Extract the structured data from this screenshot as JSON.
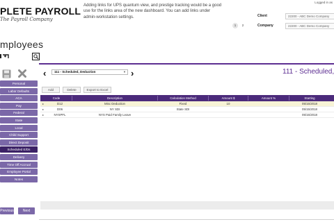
{
  "header": {
    "logo_title": "PLETE PAYROLL",
    "logo_signature": "The Payroll Company",
    "notice": "Adding links for UPS quantum view, and prestige tracking would be a good use for the links area of the new dashboard. You can add links under admin-workstation settings.",
    "logged_in": "Logged in as",
    "client_label": "Client",
    "client_value": "22200 - ABC Demo Company",
    "company_label": "Company",
    "company_value": "22200 - ABC Demo Company",
    "pages": [
      "1",
      "2"
    ],
    "active_page": "1"
  },
  "section_title": "mployees",
  "sidebar": {
    "items": [
      {
        "label": "Personal"
      },
      {
        "label": "Labor Defaults"
      },
      {
        "label": "ACA"
      },
      {
        "label": "Pay"
      },
      {
        "label": "Federal"
      },
      {
        "label": "State"
      },
      {
        "label": "Local"
      },
      {
        "label": "Child Support"
      },
      {
        "label": "Direct Deposit"
      },
      {
        "label": "Scheduled E/Ds"
      },
      {
        "label": "Delivery"
      },
      {
        "label": "Time Off Accrual"
      },
      {
        "label": "Employee Portal"
      },
      {
        "label": "Notes"
      }
    ],
    "active": "Scheduled E/Ds",
    "previous": "Previous",
    "next": "Next"
  },
  "record": {
    "selector_value": "111 - Scheduled, Deduction",
    "heading": "111 - Scheduled,"
  },
  "toolbar": {
    "add": "Add",
    "delete": "Delete",
    "export": "Export to Excel"
  },
  "grid": {
    "columns": [
      "Code",
      "Description",
      "Calculation Method",
      "Amount $",
      "Amount %",
      "Starting"
    ],
    "rows": [
      {
        "code": "D12",
        "description": "Misc Deduction",
        "method": "Fixed",
        "amount": "10",
        "percent": "",
        "starting": "05/15/2018"
      },
      {
        "code": "D06",
        "description": "NY SDI",
        "method": "State SDI",
        "amount": "",
        "percent": "",
        "starting": "05/15/2018"
      },
      {
        "code": "NYSPFL",
        "description": "NYS Paid Family Leave",
        "method": "",
        "amount": "",
        "percent": "",
        "starting": "05/15/2018"
      }
    ]
  },
  "colors": {
    "accent": "#5c2d91",
    "header_bg": "#4b2a7b",
    "sidebar_bg": "#7b68a8",
    "sidebar_active": "#3c2266",
    "row_selected": "#f7f3d6"
  }
}
